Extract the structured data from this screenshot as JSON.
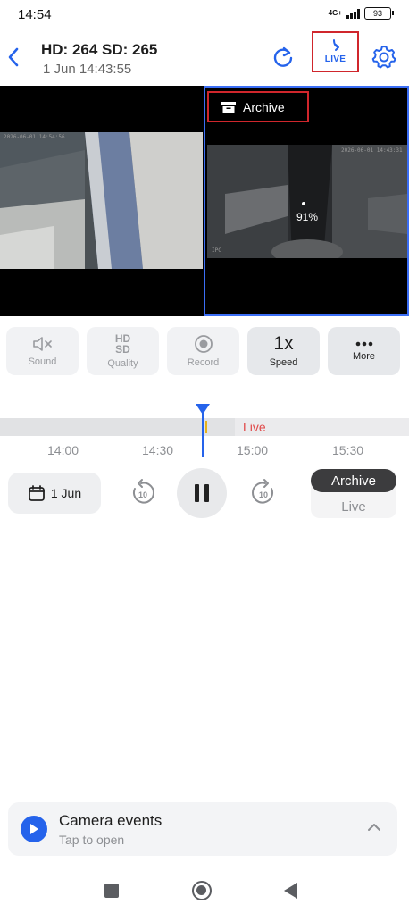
{
  "status_bar": {
    "time": "14:54",
    "network": "4G+",
    "battery": "93"
  },
  "header": {
    "title": "HD: 264 SD: 265",
    "subtitle": "1 Jun 14:43:55",
    "live_label": "LIVE",
    "accent_color": "#2563eb"
  },
  "video": {
    "left_timestamp": "2026-06-01 14:54:56",
    "right_timestamp": "2026-06-01 14:43:31",
    "archive_label": "Archive",
    "loading_percent": "91%",
    "right_overlay": "IPC"
  },
  "controls": [
    {
      "label": "Sound",
      "icon": "sound-muted-icon"
    },
    {
      "label": "Quality",
      "icon": "hd-sd-icon",
      "hd": "HD",
      "sd": "SD"
    },
    {
      "label": "Record",
      "icon": "record-icon"
    },
    {
      "label": "Speed",
      "value": "1x"
    },
    {
      "label": "More",
      "icon": "more-dots-icon"
    }
  ],
  "timeline": {
    "live_label": "Live",
    "ticks": [
      "14:00",
      "14:30",
      "15:00",
      "15:30"
    ]
  },
  "playback": {
    "date": "1 Jun",
    "skip_back": "10",
    "skip_forward": "10",
    "mode_selected": "Archive",
    "mode_other": "Live"
  },
  "events": {
    "title": "Camera events",
    "subtitle": "Tap to open"
  }
}
